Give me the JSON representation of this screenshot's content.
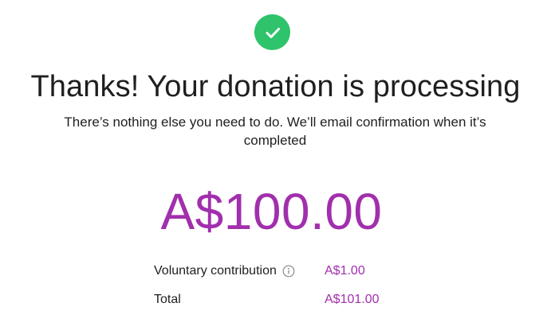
{
  "colors": {
    "success": "#2fc36b",
    "accent": "#a12fad",
    "text": "#1f1f1f",
    "muted_icon": "#8a8a8a"
  },
  "status": {
    "icon": "check-circle-icon",
    "headline": "Thanks! Your donation is processing",
    "message": "There’s nothing else you need to do. We’ll email confirmation when it’s completed"
  },
  "donation": {
    "amount": "A$100.00"
  },
  "summary": {
    "contribution": {
      "label": "Voluntary contribution",
      "info_icon": "info-icon",
      "value": "A$1.00"
    },
    "total": {
      "label": "Total",
      "value": "A$101.00"
    }
  }
}
